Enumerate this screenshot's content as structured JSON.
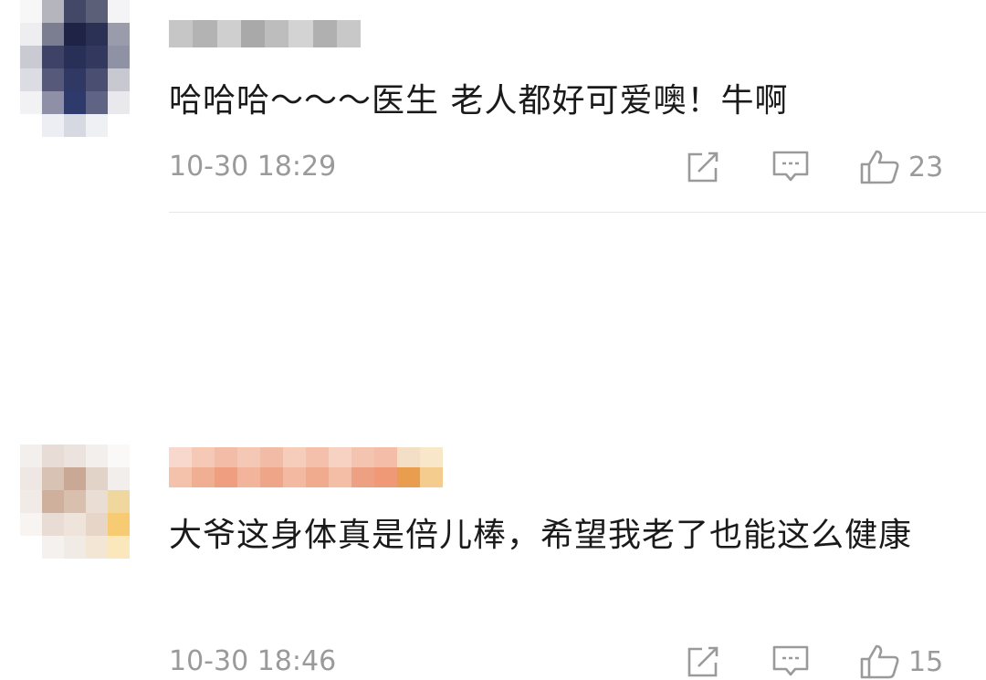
{
  "comments": [
    {
      "time": "10-30 18:29",
      "text": "哈哈哈～～～医生 老人都好可爱噢！牛啊",
      "likes": "23",
      "avatar_pixels": [
        [
          "#f7f7f8",
          "#b5b6bd",
          "#444868",
          "#5c5f78",
          "#f4f4f6"
        ],
        [
          "#eeeef0",
          "#7b7e90",
          "#1f2447",
          "#2b3055",
          "#9a9cab"
        ],
        [
          "#c9cad2",
          "#3d4266",
          "#283058",
          "#33395e",
          "#8f92a5"
        ],
        [
          "#dcdde3",
          "#56597a",
          "#2f3964",
          "#4a4f72",
          "#c7c8d0"
        ],
        [
          "#f2f2f4",
          "#8d90a6",
          "#2e3a6b",
          "#5f6384",
          "#e9e9ed"
        ],
        [
          "#ffffff",
          "#eceef3",
          "#d7d9e2",
          "#eef0f4",
          "#ffffff"
        ]
      ],
      "name_pixels": [
        "#c6c6c6",
        "#b3b3b3",
        "#cfcfcf",
        "#a9a9a9",
        "#bdbdbd",
        "#d3d3d3",
        "#b0b0b0",
        "#c8c8c8"
      ]
    },
    {
      "time": "10-30 18:46",
      "text": "大爷这身体真是倍儿棒，希望我老了也能这么健康",
      "likes": "15",
      "avatar_pixels": [
        [
          "#f2efed",
          "#e7ddd6",
          "#ece3de",
          "#f3efed",
          "#faf9f8"
        ],
        [
          "#eee7e3",
          "#d8c2b4",
          "#c9a996",
          "#e2d3c9",
          "#f2eeec"
        ],
        [
          "#f1ebe7",
          "#cfb09c",
          "#d8bfae",
          "#e9ddd4",
          "#f0d79e"
        ],
        [
          "#f7f4f2",
          "#e8dcd4",
          "#eee4dc",
          "#e7d6c8",
          "#f6cb72"
        ],
        [
          "#ffffff",
          "#f5f1ee",
          "#f1ebe6",
          "#f3e6d4",
          "#fbe7bc"
        ]
      ],
      "name_pixels_top": [
        "#f8d8cc",
        "#f6c9b6",
        "#f3bca6",
        "#f5c7b5",
        "#f2bba6",
        "#f6cdbb",
        "#f4c0ab",
        "#f7d2c2",
        "#f5c4b0",
        "#f3bda8",
        "#f2dfc6",
        "#f8e7c8"
      ],
      "name_pixels_bottom": [
        "#f4c1ab",
        "#f0ae93",
        "#ef9f80",
        "#f2b49b",
        "#efa587",
        "#f3b9a1",
        "#f0aa8e",
        "#f4bda6",
        "#eea083",
        "#f09977",
        "#e99d4f",
        "#f4cd8e"
      ]
    }
  ],
  "colors": {
    "meta_gray": "#9a9a9a",
    "text": "#1a1a1a",
    "divider": "#e6e6e6"
  },
  "icons": [
    "share-icon",
    "reply-icon",
    "like-icon"
  ]
}
